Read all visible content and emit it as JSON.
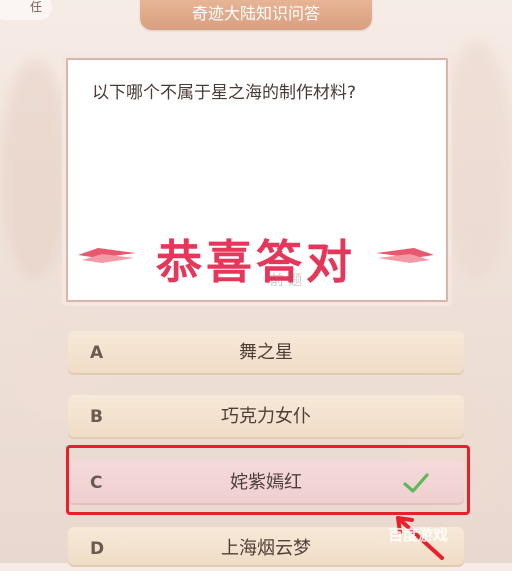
{
  "top_left_label": "任",
  "title": "奇迹大陆知识问答",
  "question": "以下哪个不属于星之海的制作材料?",
  "result_banner": "恭喜答对",
  "faded_subtitle": "前 题",
  "options": [
    {
      "letter": "A",
      "text": "舞之星"
    },
    {
      "letter": "B",
      "text": "巧克力女仆"
    },
    {
      "letter": "C",
      "text": "姹紫嫣红",
      "correct": true
    },
    {
      "letter": "D",
      "text": "上海烟云梦"
    }
  ],
  "watermark": "百度游戏",
  "colors": {
    "accent_red": "#e8202a",
    "banner_pink": "#e5375a",
    "check_green": "#5fb85a",
    "ribbon": "#dca284"
  }
}
